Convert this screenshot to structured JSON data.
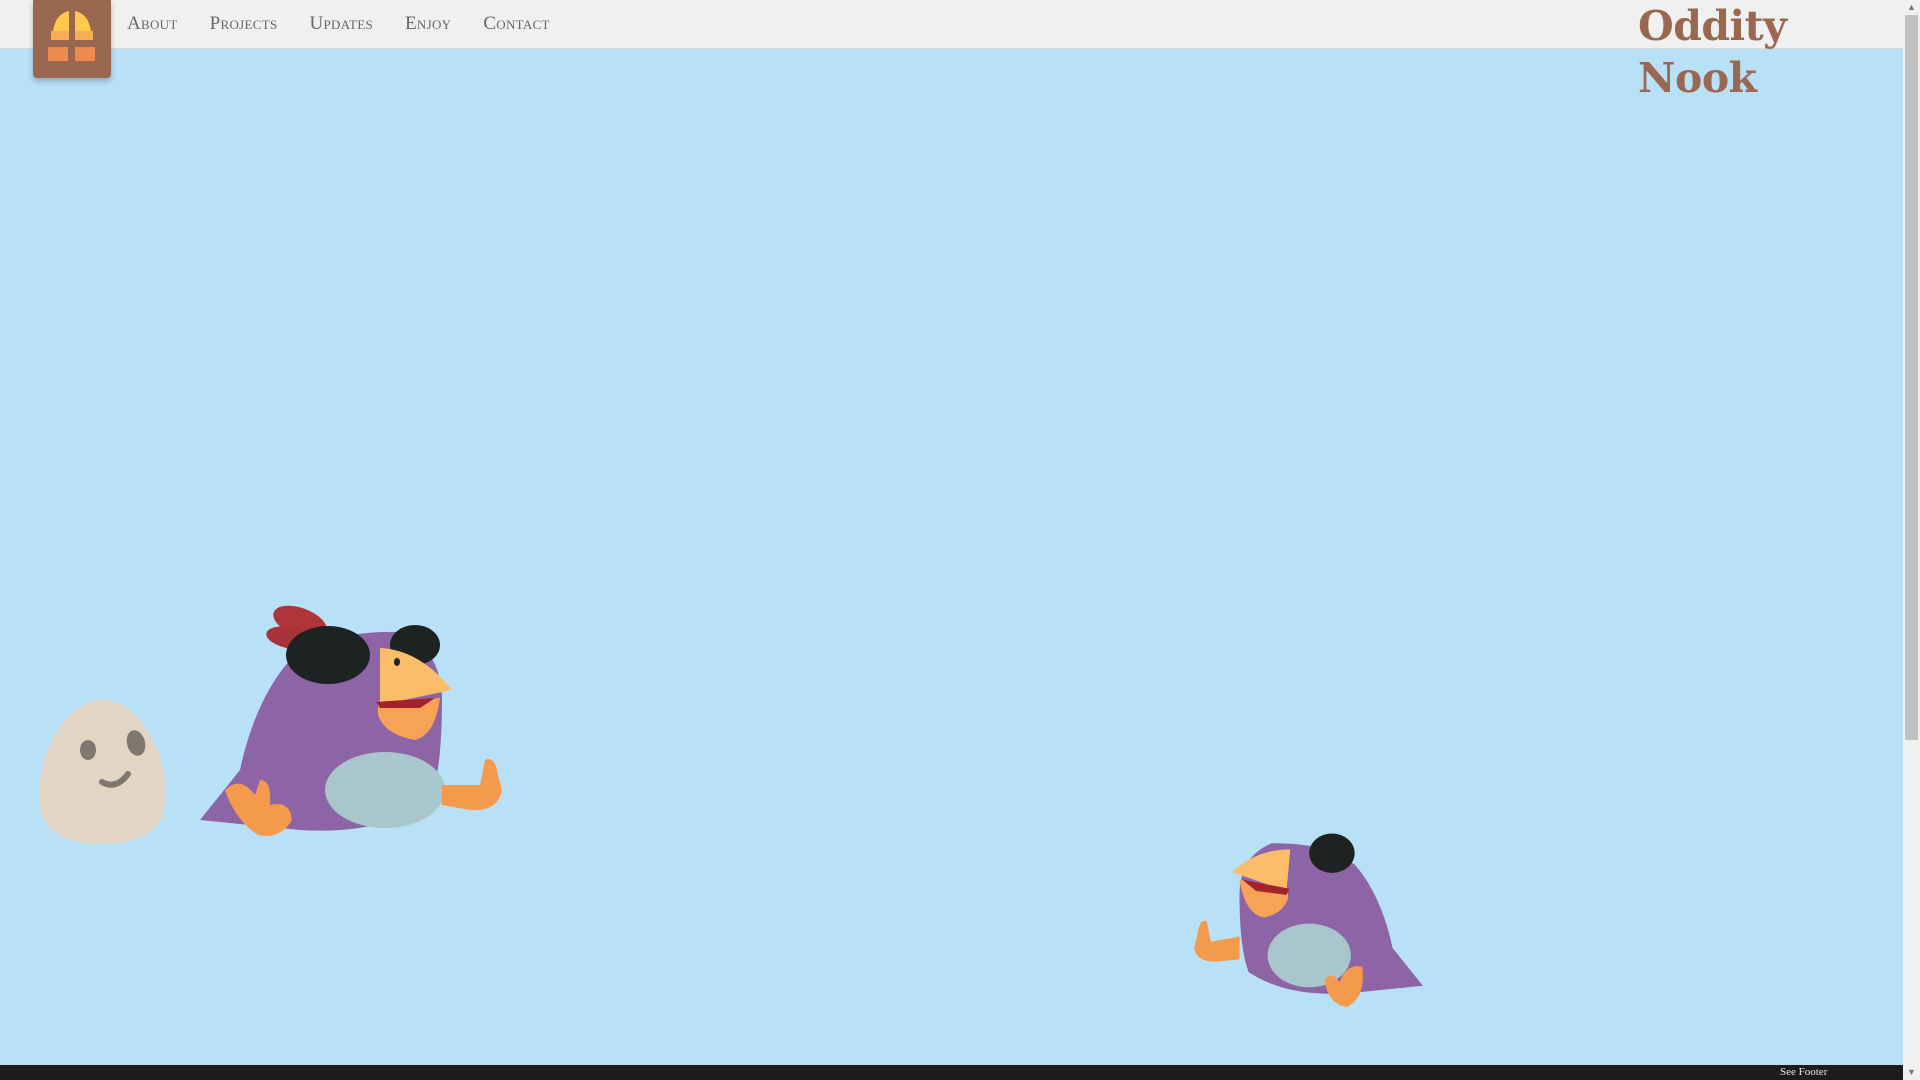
{
  "nav": {
    "items": [
      {
        "label": "About"
      },
      {
        "label": "Projects"
      },
      {
        "label": "Updates"
      },
      {
        "label": "Enjoy"
      },
      {
        "label": "Contact"
      }
    ]
  },
  "brand": {
    "name": "Oddity Nook"
  },
  "footer": {
    "label": "See Footer"
  },
  "colors": {
    "header_bg": "#f0f0f0",
    "sky": "#b8e0f7",
    "brand": "#9a6850",
    "footer_bg": "#1c1c1c"
  }
}
